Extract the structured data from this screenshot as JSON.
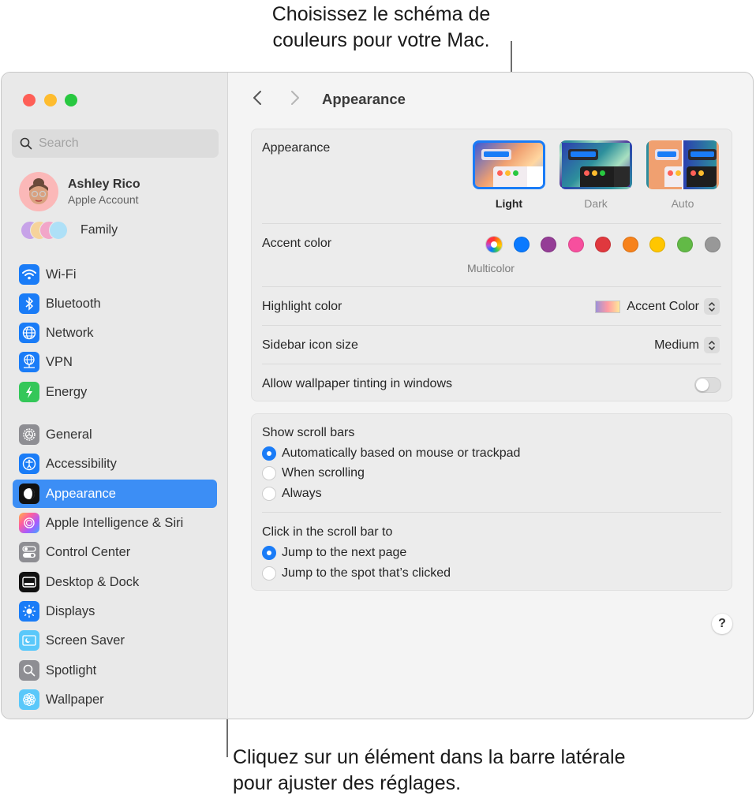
{
  "callouts": {
    "top": "Choisissez le schéma de couleurs pour votre Mac.",
    "bottom": "Cliquez sur un élément dans la barre latérale pour ajuster des réglages."
  },
  "sidebar": {
    "search_placeholder": "Search",
    "account": {
      "name": "Ashley Rico",
      "subtitle": "Apple Account"
    },
    "family_label": "Family",
    "items": [
      {
        "label": "Wi-Fi",
        "icon": "wifi-icon",
        "color": "#1a7cf7"
      },
      {
        "label": "Bluetooth",
        "icon": "bluetooth-icon",
        "color": "#1a7cf7"
      },
      {
        "label": "Network",
        "icon": "globe-icon",
        "color": "#1a7cf7"
      },
      {
        "label": "VPN",
        "icon": "vpn-globe-icon",
        "color": "#1a7cf7"
      },
      {
        "label": "Energy",
        "icon": "lightning-icon",
        "color": "#34c759"
      },
      {
        "label": "General",
        "icon": "gear-icon",
        "color": "#8e8e93"
      },
      {
        "label": "Accessibility",
        "icon": "accessibility-icon",
        "color": "#1a7cf7"
      },
      {
        "label": "Appearance",
        "icon": "appearance-icon",
        "color": "#111111",
        "active": true
      },
      {
        "label": "Apple Intelligence & Siri",
        "icon": "siri-icon",
        "color": "#ff6f9c"
      },
      {
        "label": "Control Center",
        "icon": "toggles-icon",
        "color": "#8e8e93"
      },
      {
        "label": "Desktop & Dock",
        "icon": "dock-icon",
        "color": "#111111"
      },
      {
        "label": "Displays",
        "icon": "sun-icon",
        "color": "#1a7cf7"
      },
      {
        "label": "Screen Saver",
        "icon": "screensaver-icon",
        "color": "#5ac8fa"
      },
      {
        "label": "Spotlight",
        "icon": "magnifier-icon",
        "color": "#8e8e93"
      },
      {
        "label": "Wallpaper",
        "icon": "flower-icon",
        "color": "#5ac8fa"
      }
    ]
  },
  "main": {
    "title": "Appearance",
    "appearance": {
      "label": "Appearance",
      "options": [
        {
          "label": "Light",
          "selected": true
        },
        {
          "label": "Dark",
          "selected": false
        },
        {
          "label": "Auto",
          "selected": false
        }
      ]
    },
    "accent": {
      "label": "Accent color",
      "selected_label": "Multicolor",
      "colors": [
        "multicolor",
        "#0a7aff",
        "#953d96",
        "#f74f9e",
        "#e0383e",
        "#f7821b",
        "#ffc600",
        "#62ba46",
        "#989898"
      ]
    },
    "highlight": {
      "label": "Highlight color",
      "value": "Accent Color"
    },
    "sidebar_icon_size": {
      "label": "Sidebar icon size",
      "value": "Medium"
    },
    "wallpaper_tinting": {
      "label": "Allow wallpaper tinting in windows",
      "enabled": false
    },
    "scroll_bars": {
      "label": "Show scroll bars",
      "options": [
        {
          "label": "Automatically based on mouse or trackpad",
          "checked": true
        },
        {
          "label": "When scrolling",
          "checked": false
        },
        {
          "label": "Always",
          "checked": false
        }
      ]
    },
    "click_scroll": {
      "label": "Click in the scroll bar to",
      "options": [
        {
          "label": "Jump to the next page",
          "checked": true
        },
        {
          "label": "Jump to the spot that’s clicked",
          "checked": false
        }
      ]
    },
    "help_label": "?"
  }
}
